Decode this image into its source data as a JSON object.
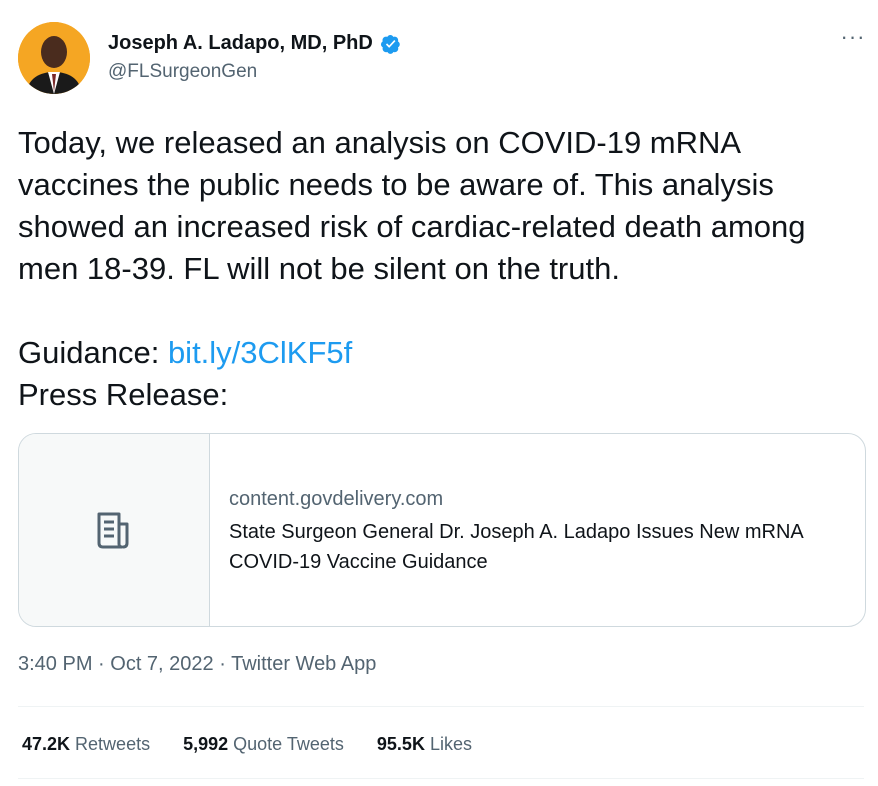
{
  "author": {
    "display_name": "Joseph A. Ladapo, MD, PhD",
    "handle": "@FLSurgeonGen",
    "verified": true,
    "avatar_bg": "#f5a623"
  },
  "menu_icon": "more-horizontal-icon",
  "tweet": {
    "paragraph1": "Today, we released an analysis on COVID-19 mRNA vaccines the public needs to be aware of. This analysis showed an increased risk of cardiac-related death among men 18-39. FL will not be silent on the truth.",
    "guidance_label": "Guidance: ",
    "guidance_link": "bit.ly/3ClKF5f",
    "press_label": "Press Release:"
  },
  "card": {
    "icon": "document-icon",
    "domain": "content.govdelivery.com",
    "title": "State Surgeon General Dr. Joseph A. Ladapo Issues New mRNA COVID-19 Vaccine Guidance"
  },
  "meta": {
    "time": "3:40 PM",
    "sep1": " · ",
    "date": "Oct 7, 2022",
    "sep2": " · ",
    "source": "Twitter Web App"
  },
  "stats": {
    "retweets_count": "47.2K",
    "retweets_label": " Retweets",
    "quotes_count": "5,992",
    "quotes_label": " Quote Tweets",
    "likes_count": "95.5K",
    "likes_label": " Likes"
  },
  "colors": {
    "link": "#1d9bf0",
    "secondary_text": "#536471",
    "verified": "#1d9bf0"
  }
}
